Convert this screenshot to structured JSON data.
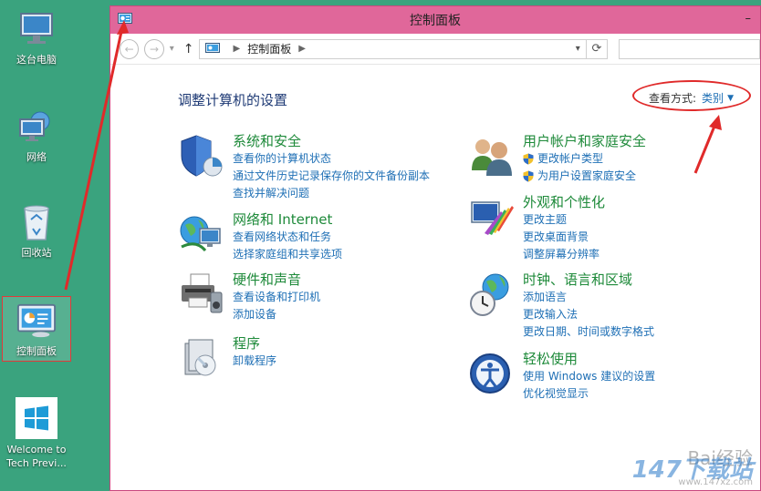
{
  "desktop": {
    "icons": [
      {
        "label": "这台电脑"
      },
      {
        "label": "网络"
      },
      {
        "label": "回收站"
      },
      {
        "label": "控制面板"
      },
      {
        "label": "Welcome to Tech Previ..."
      }
    ]
  },
  "window": {
    "title": "控制面板",
    "address": {
      "crumb": "控制面板"
    },
    "heading": "调整计算机的设置",
    "view_by": {
      "label": "查看方式:",
      "value": "类别"
    }
  },
  "categories": [
    {
      "title": "系统和安全",
      "links": [
        "查看你的计算机状态",
        "通过文件历史记录保存你的文件备份副本",
        "查找并解决问题"
      ]
    },
    {
      "title": "网络和 Internet",
      "links": [
        "查看网络状态和任务",
        "选择家庭组和共享选项"
      ]
    },
    {
      "title": "硬件和声音",
      "links": [
        "查看设备和打印机",
        "添加设备"
      ]
    },
    {
      "title": "程序",
      "links": [
        "卸载程序"
      ]
    },
    {
      "title": "用户帐户和家庭安全",
      "links": [
        "更改帐户类型",
        "为用户设置家庭安全"
      ]
    },
    {
      "title": "外观和个性化",
      "links": [
        "更改主题",
        "更改桌面背景",
        "调整屏幕分辨率"
      ]
    },
    {
      "title": "时钟、语言和区域",
      "links": [
        "添加语言",
        "更改输入法",
        "更改日期、时间或数字格式"
      ]
    },
    {
      "title": "轻松使用",
      "links": [
        "使用 Windows 建议的设置",
        "优化视觉显示"
      ]
    }
  ],
  "watermark": {
    "line1": "Bai经验",
    "brand": "147下载站",
    "line2": "www.147xz.com"
  },
  "colors": {
    "titlebar": "#e0679a",
    "desktop": "#3aa37e",
    "link": "#1e6fb5",
    "category_title": "#1e8a3a",
    "annotation": "#e02a2a"
  }
}
